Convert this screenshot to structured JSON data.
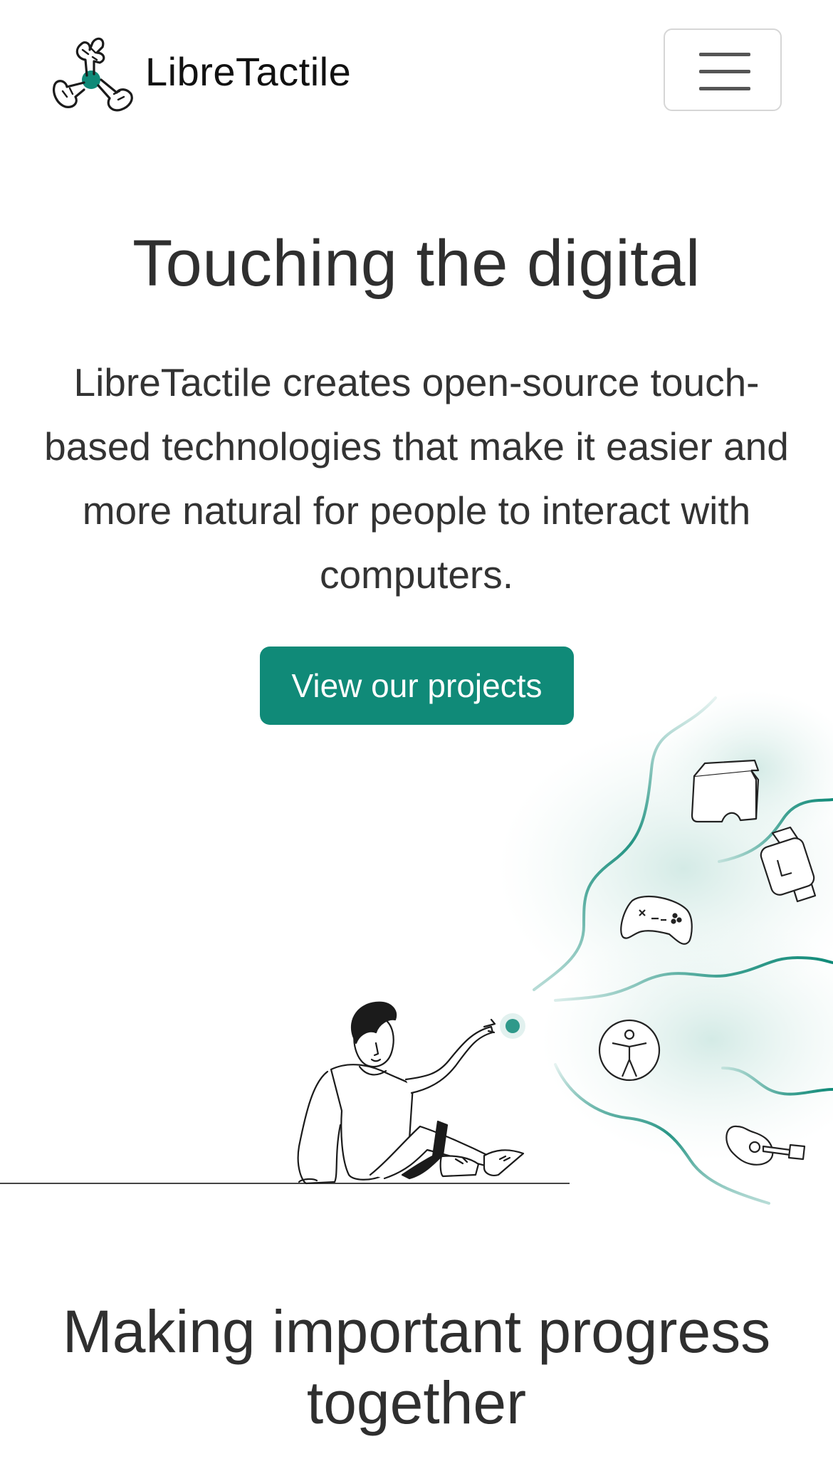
{
  "brand": {
    "name": "LibreTactile",
    "accent_color": "#108a78"
  },
  "navbar": {
    "menu_icon": "hamburger-menu-icon"
  },
  "hero": {
    "title": "Touching the digital",
    "lead": "LibreTactile creates open-source touch-based technologies that make it easier and more natural for people to interact with computers.",
    "cta_label": "View our projects"
  },
  "illustration": {
    "icons": [
      "vr-headset-icon",
      "smartwatch-icon",
      "gamepad-icon",
      "accessibility-icon",
      "guitar-icon"
    ]
  },
  "section2": {
    "title": "Making important progress together"
  }
}
